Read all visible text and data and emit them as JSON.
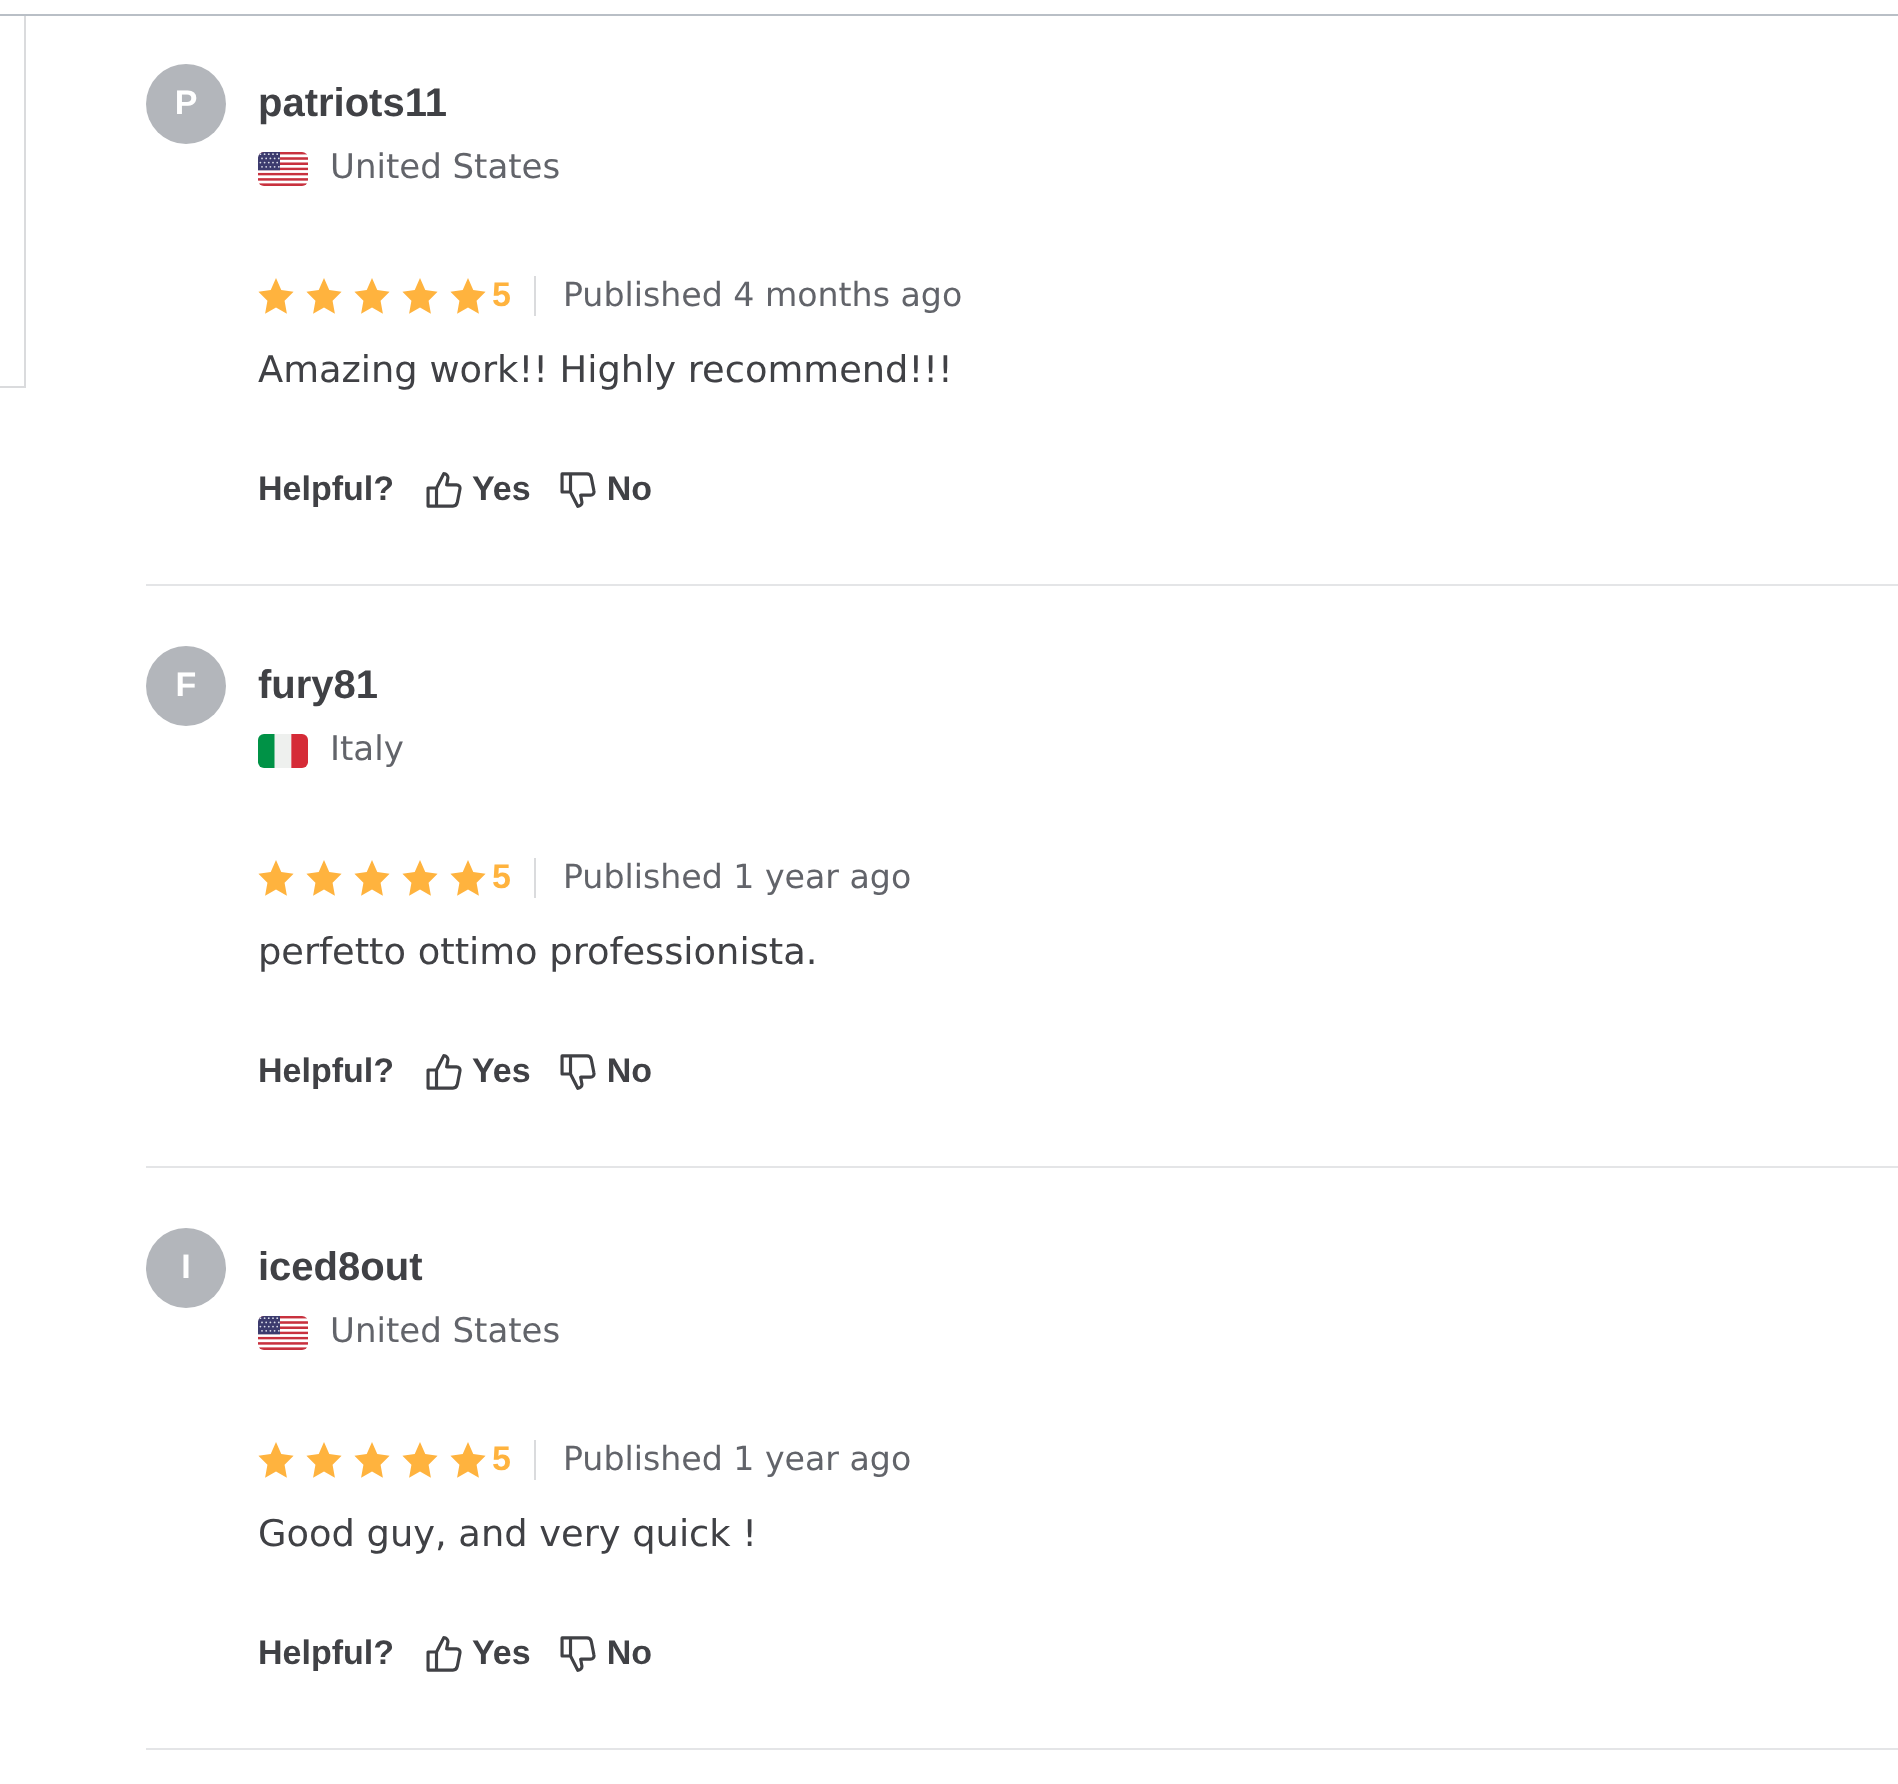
{
  "reviews": [
    {
      "avatar_letter": "P",
      "username": "patriots11",
      "country": "United States",
      "flag": {
        "kind": "us"
      },
      "stars": 5,
      "rating": "5",
      "published": "Published 4 months ago",
      "text": "Amazing work!! Highly recommend!!!",
      "helpful_label": "Helpful?",
      "yes": "Yes",
      "no": "No"
    },
    {
      "avatar_letter": "F",
      "username": "fury81",
      "country": "Italy",
      "flag": {
        "kind": "it"
      },
      "stars": 5,
      "rating": "5",
      "published": "Published 1 year ago",
      "text": "perfetto ottimo professionista.",
      "helpful_label": "Helpful?",
      "yes": "Yes",
      "no": "No"
    },
    {
      "avatar_letter": "I",
      "username": "iced8out",
      "country": "United States",
      "flag": {
        "kind": "us"
      },
      "stars": 5,
      "rating": "5",
      "published": "Published 1 year ago",
      "text": "Good guy, and very quick !",
      "helpful_label": "Helpful?",
      "yes": "Yes",
      "no": "No"
    }
  ]
}
